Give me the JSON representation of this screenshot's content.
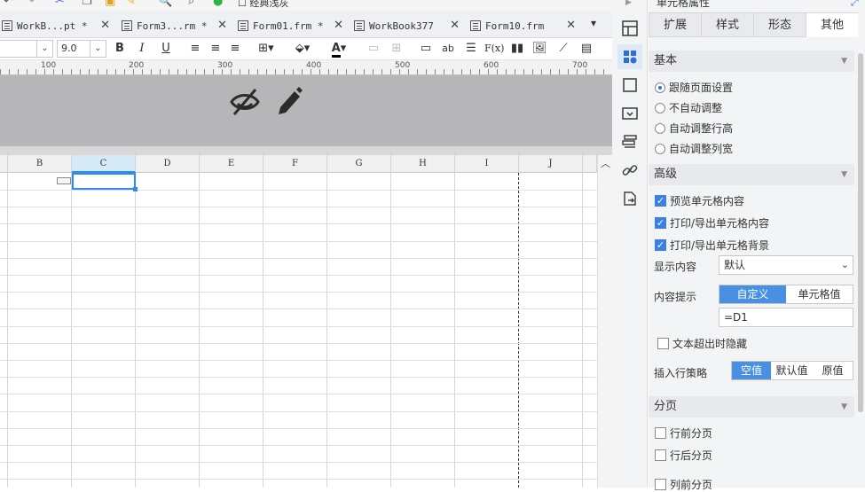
{
  "topbar": {
    "classic_label": "经典浅灰"
  },
  "tabs": [
    {
      "label": "WorkB...pt *",
      "close": "✕",
      "active": false
    },
    {
      "label": "Form3...rm *",
      "close": "✕",
      "active": false
    },
    {
      "label": "Form01.frm *",
      "close": "✕",
      "active": false
    },
    {
      "label": "WorkBook377",
      "close": "✕",
      "active": false
    },
    {
      "label": "Form10.frm",
      "close": "✕",
      "active": false
    }
  ],
  "format_toolbar": {
    "font_size": "9.0",
    "bold": "B",
    "italic": "I",
    "underline": "U",
    "text_style_ab": "ab",
    "formula": "F(x)"
  },
  "ruler": {
    "ticks": [
      "100",
      "200",
      "300",
      "400",
      "500",
      "600",
      "700"
    ]
  },
  "grid": {
    "columns": [
      "B",
      "C",
      "D",
      "E",
      "F",
      "G",
      "H",
      "I",
      "J"
    ],
    "selected_column": "C"
  },
  "panel": {
    "title": "单元格属性",
    "tabs": [
      "扩展",
      "样式",
      "形态",
      "其他"
    ],
    "active_tab": "其他",
    "basic": {
      "title": "基本",
      "options": [
        "跟随页面设置",
        "不自动调整",
        "自动调整行高",
        "自动调整列宽"
      ],
      "selected": "跟随页面设置"
    },
    "advanced": {
      "title": "高级",
      "checks": [
        "预览单元格内容",
        "打印/导出单元格内容",
        "打印/导出单元格背景"
      ],
      "display_label": "显示内容",
      "display_value": "默认",
      "tip_label": "内容提示",
      "tip_options": [
        "自定义",
        "单元格值"
      ],
      "tip_selected": "自定义",
      "tip_value": "=D1",
      "overflow_hide": "文本超出时隐藏",
      "insert_label": "插入行策略",
      "insert_options": [
        "空值",
        "默认值",
        "原值"
      ],
      "insert_selected": "空值"
    },
    "paging": {
      "title": "分页",
      "options": [
        "行前分页",
        "行后分页",
        "列前分页"
      ]
    }
  }
}
